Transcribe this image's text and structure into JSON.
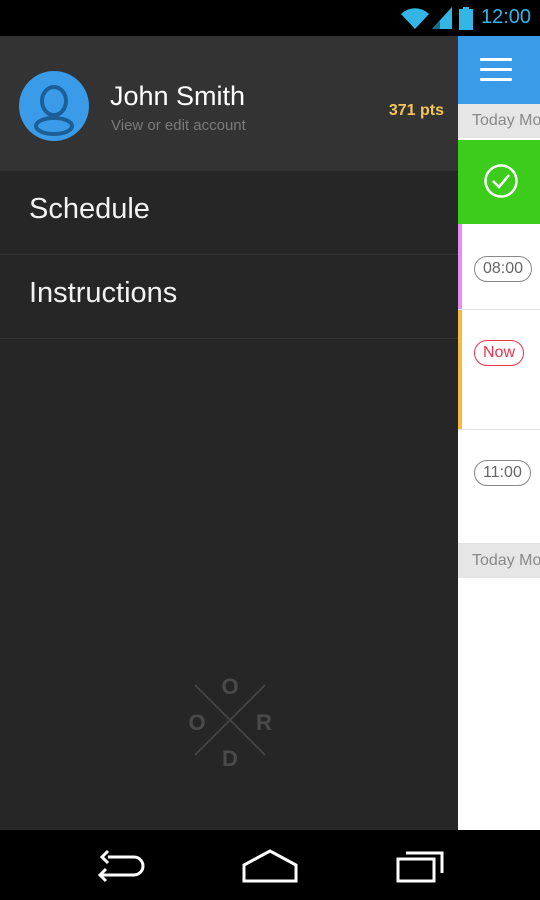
{
  "status_bar": {
    "time": "12:00",
    "icons": [
      "wifi-icon",
      "signal-icon",
      "battery-icon"
    ],
    "accent": "#33b5e5"
  },
  "drawer": {
    "profile": {
      "name": "John Smith",
      "subtitle": "View or edit account",
      "points": "371 pts",
      "points_color": "#f4c55a",
      "avatar_icon": "user-avatar-icon"
    },
    "menu": [
      {
        "label": "Schedule"
      },
      {
        "label": "Instructions"
      }
    ],
    "logo_letters": [
      "O",
      "O",
      "R",
      "D"
    ]
  },
  "background_app": {
    "toolbar_color": "#3a9ce8",
    "day_headers": [
      "Today Mo",
      "Today Mo"
    ],
    "completed_color": "#3ccd1c",
    "events": [
      {
        "time": "08:00",
        "accent": "#e48ef2"
      },
      {
        "time": "Now",
        "accent": "#f6b942"
      },
      {
        "time": "11:00",
        "accent": ""
      }
    ]
  },
  "nav_bar": {
    "buttons": [
      "back-icon",
      "home-icon",
      "recents-icon"
    ]
  }
}
